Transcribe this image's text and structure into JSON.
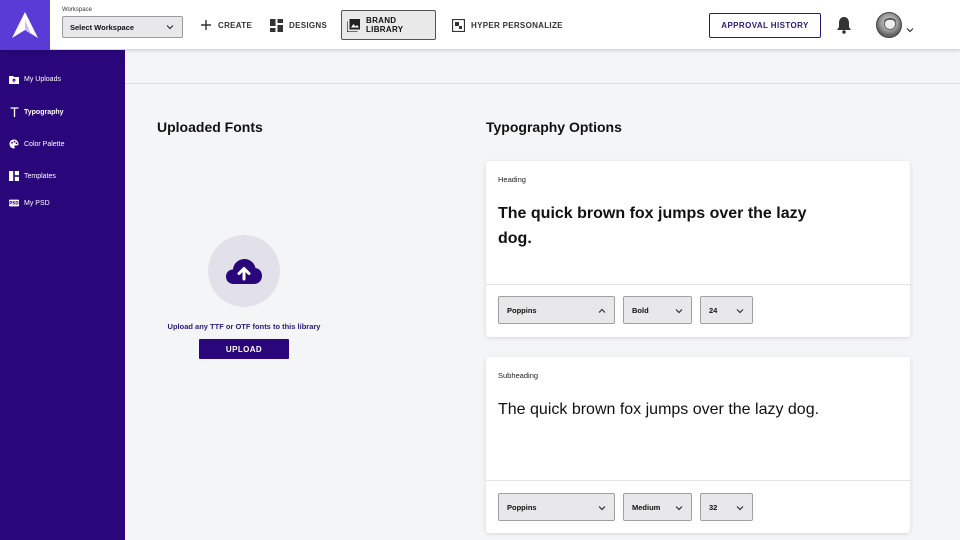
{
  "header": {
    "workspace_label": "Workspace",
    "workspace_value": "Select Workspace",
    "nav": {
      "create": "CREATE",
      "designs": "DESIGNS",
      "brand_library": "BRAND LIBRARY",
      "hyper_personalize": "HYPER PERSONALIZE"
    },
    "approval_history": "APPROVAL HISTORY"
  },
  "sidebar": {
    "items": [
      {
        "label": "My Uploads",
        "icon": "upload-folder-icon"
      },
      {
        "label": "Typography",
        "icon": "typography-icon"
      },
      {
        "label": "Color Palette",
        "icon": "palette-icon"
      },
      {
        "label": "Templates",
        "icon": "templates-icon"
      },
      {
        "label": "My PSD",
        "icon": "psd-icon"
      }
    ],
    "active": "Typography"
  },
  "uploaded_fonts": {
    "title": "Uploaded Fonts",
    "hint": "Upload any TTF or OTF fonts to this library",
    "upload_button": "UPLOAD"
  },
  "typography_options": {
    "title": "Typography Options",
    "cards": [
      {
        "label": "Heading",
        "sample": "The quick brown fox jumps over the lazy dog.",
        "font": "Poppins",
        "weight": "Bold",
        "size": "24"
      },
      {
        "label": "Subheading",
        "sample": "The quick brown fox jumps over the lazy dog.",
        "font": "Poppins",
        "weight": "Medium",
        "size": "32"
      }
    ]
  },
  "colors": {
    "accent": "#29067a",
    "logo_bg": "#5b3bd6",
    "page_bg": "#f4f5f7"
  }
}
